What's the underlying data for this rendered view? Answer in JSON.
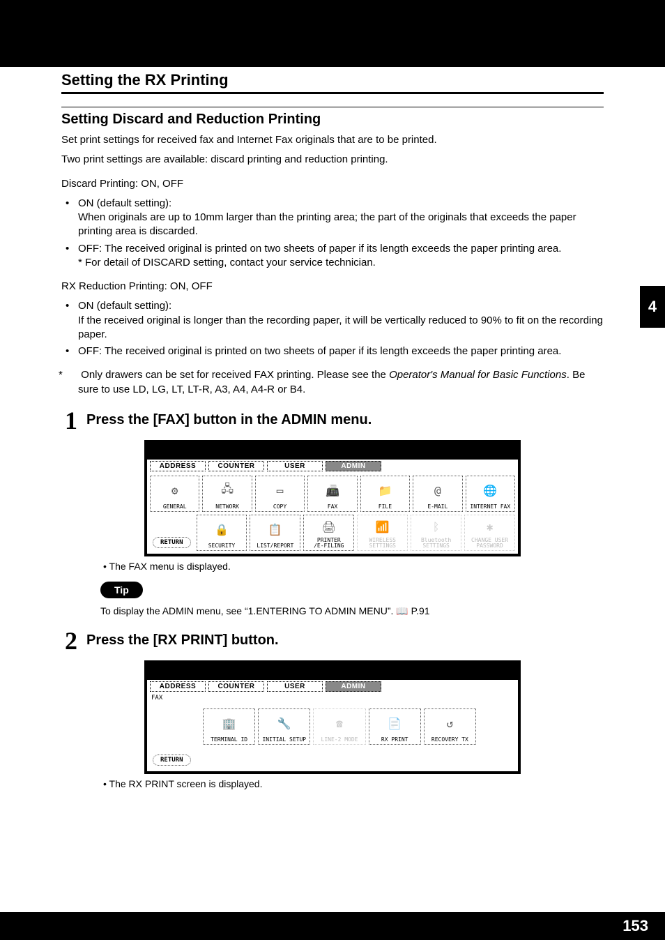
{
  "header": {
    "title": "Setting the RX Printing"
  },
  "section": {
    "title": "Setting Discard and Reduction Printing"
  },
  "intro": {
    "p1": "Set print settings for received fax and Internet Fax originals that are to be printed.",
    "p2": "Two print settings are available: discard printing and reduction printing."
  },
  "discard": {
    "heading": "Discard Printing: ON, OFF",
    "on_label": "ON (default setting):",
    "on_text": "When originals are up to 10mm larger than the printing area; the part of the originals that exceeds the paper printing area is discarded.",
    "off_text": "OFF: The received original is printed on two sheets of paper if its length exceeds the paper printing area.",
    "note": "* For detail of DISCARD setting, contact your service technician."
  },
  "rx": {
    "heading": "RX Reduction Printing: ON, OFF",
    "on_label": "ON (default setting):",
    "on_text": "If the received original is longer than the recording paper, it will be vertically reduced to 90% to fit on the recording paper.",
    "off_text": "OFF: The received original is printed on two sheets of paper if its length exceeds the paper printing area."
  },
  "footnote": {
    "prefix": "Only drawers can be set for received FAX printing.   Please see the ",
    "italic": "Operator's Manual for Basic Functions",
    "suffix": ". Be sure to use LD, LG, LT, LT-R, A3, A4, A4-R or B4."
  },
  "step1": {
    "num": "1",
    "title": "Press the [FAX] button in the ADMIN menu.",
    "note": "The FAX menu is displayed."
  },
  "ss1": {
    "tabs": [
      "ADDRESS",
      "COUNTER",
      "USER",
      "ADMIN"
    ],
    "row1": [
      "GENERAL",
      "NETWORK",
      "COPY",
      "FAX",
      "FILE",
      "E-MAIL",
      "INTERNET FAX"
    ],
    "row2": [
      "SECURITY",
      "LIST/REPORT",
      "PRINTER\n/E-FILING",
      "WIRELESS\nSETTINGS",
      "Bluetooth\nSETTINGS",
      "CHANGE USER\nPASSWORD"
    ],
    "return": "RETURN"
  },
  "tip": {
    "label": "Tip",
    "text_prefix": "To display the ADMIN menu, see “1.ENTERING TO ADMIN MENU”.  ",
    "ref": "P.91"
  },
  "step2": {
    "num": "2",
    "title": "Press the [RX PRINT] button.",
    "note": "The RX PRINT screen is displayed."
  },
  "ss2": {
    "tabs": [
      "ADDRESS",
      "COUNTER",
      "USER",
      "ADMIN"
    ],
    "sublabel": "FAX",
    "row": [
      "TERMINAL ID",
      "INITIAL SETUP",
      "LINE-2 MODE",
      "RX PRINT",
      "RECOVERY TX"
    ],
    "return": "RETURN"
  },
  "chapter_tab": "4",
  "page_number": "153"
}
